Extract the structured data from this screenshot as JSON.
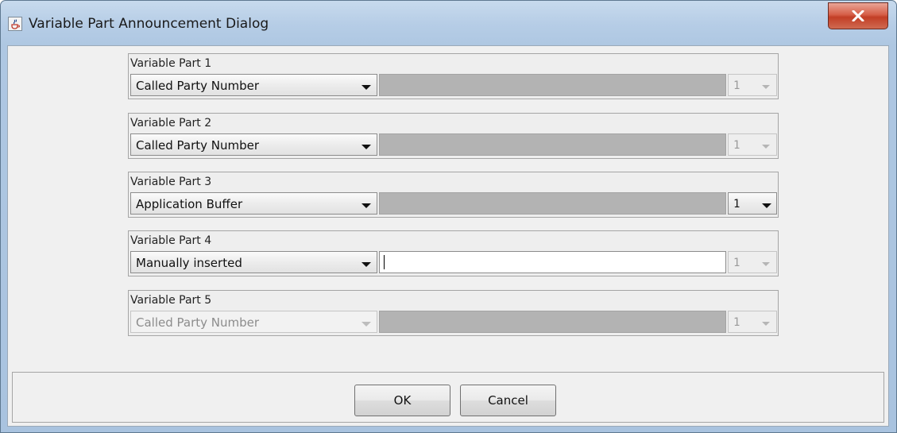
{
  "window": {
    "title": "Variable Part Announcement Dialog",
    "accent": "#b6cde6",
    "close_color": "#c23e26"
  },
  "parts": [
    {
      "label": "Variable Part 1",
      "selection": "Called Party Number",
      "count": "1",
      "selection_enabled": true,
      "count_enabled": false,
      "text_enabled": false
    },
    {
      "label": "Variable Part 2",
      "selection": "Called Party Number",
      "count": "1",
      "selection_enabled": true,
      "count_enabled": false,
      "text_enabled": false
    },
    {
      "label": "Variable Part 3",
      "selection": "Application Buffer",
      "count": "1",
      "selection_enabled": true,
      "count_enabled": true,
      "text_enabled": false
    },
    {
      "label": "Variable Part 4",
      "selection": "Manually inserted",
      "count": "1",
      "selection_enabled": true,
      "count_enabled": false,
      "text_enabled": true,
      "text_value": ""
    },
    {
      "label": "Variable Part 5",
      "selection": "Called Party Number",
      "count": "1",
      "selection_enabled": false,
      "count_enabled": false,
      "text_enabled": false
    }
  ],
  "buttons": {
    "ok": "OK",
    "cancel": "Cancel"
  },
  "icons": {
    "app": "java-cup-icon",
    "close": "close-x-icon"
  }
}
